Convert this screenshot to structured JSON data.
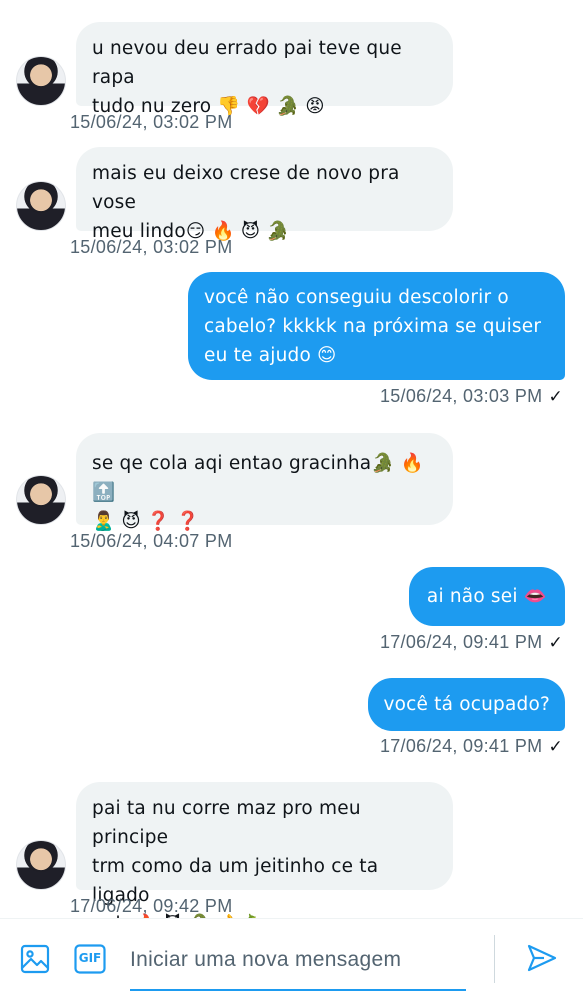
{
  "messages": [
    {
      "direction": "in",
      "lines": [
        "u nevou deu errado pai teve que rapa",
        "tudo nu zero 👎 💔 🐊 😡"
      ],
      "timestamp": "15/06/24, 03:02 PM"
    },
    {
      "direction": "in",
      "lines": [
        "mais eu deixo crese de novo pra vose",
        "meu lindo😏 🔥 😈 🐊"
      ],
      "timestamp": "15/06/24, 03:02 PM"
    },
    {
      "direction": "out",
      "lines": [
        "você não conseguiu descolorir o",
        "cabelo? kkkkk na próxima se quiser",
        "eu te ajudo 😊"
      ],
      "timestamp": "15/06/24, 03:03 PM",
      "status": "✓"
    },
    {
      "direction": "in",
      "lines": [
        "se qe cola aqi entao gracinha🐊 🔥 🔝",
        "🙎‍♂️ 😈 ❓ ❓"
      ],
      "timestamp": "15/06/24, 04:07 PM"
    },
    {
      "direction": "out",
      "lines": [
        "ai não sei 👄"
      ],
      "timestamp": "17/06/24, 09:41 PM",
      "status": "✓"
    },
    {
      "direction": "out",
      "lines": [
        "você tá ocupado?"
      ],
      "timestamp": "17/06/24, 09:41 PM",
      "status": "✓"
    },
    {
      "direction": "in",
      "lines": [
        "pai ta nu corre maz pro meu principe",
        "trm como da um jeitinho ce ta ligado",
        "neh 🔥 😈 🐊 👌 🍆"
      ],
      "timestamp": "17/06/24, 09:42 PM"
    }
  ],
  "composer": {
    "placeholder": "Iniciar uma nova mensagem",
    "gif_label": "GIF",
    "image_icon": "image-icon",
    "send_icon": "send-icon"
  },
  "colors": {
    "outgoing_bubble": "#1d9bf0",
    "incoming_bubble": "#eff3f4",
    "timestamp": "#536471",
    "accent": "#1d9bf0"
  }
}
